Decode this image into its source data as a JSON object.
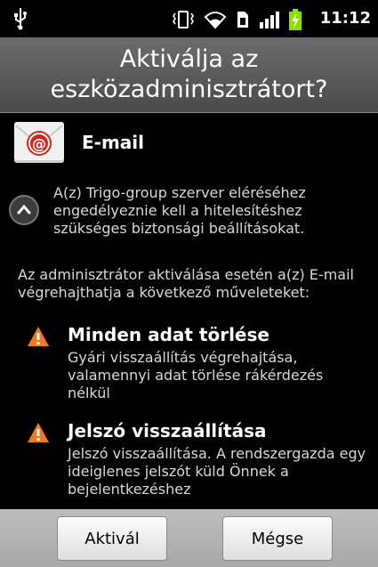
{
  "status_bar": {
    "time": "11:12",
    "icons": [
      "usb-icon",
      "vibrate-icon",
      "wifi-icon",
      "sim-icon",
      "signal-icon",
      "battery-charging-icon"
    ]
  },
  "dialog": {
    "title_line1": "Aktiválja az",
    "title_line2": "eszközadminisztrátort?"
  },
  "app": {
    "name": "E-mail",
    "icon": "email-app-icon"
  },
  "description": "A(z) Trigo-group szerver eléréséhez engedélyeznie kell a hitelesítéshez szükséges biztonsági beállításokat.",
  "admin_text": "Az adminisztrátor aktiválása esetén a(z) E-mail végrehajthatja a következő műveleteket:",
  "permissions": [
    {
      "title": "Minden adat törlése",
      "description": "Gyári visszaállítás végrehajtása, valamennyi adat törlése rákérdezés nélkül"
    },
    {
      "title": "Jelszó visszaállítása",
      "description": "Jelszó visszaállítása. A rendszergazda egy ideiglenes jelszót küld Önnek a bejelentkezéshez"
    }
  ],
  "buttons": {
    "activate": "Aktivál",
    "cancel": "Mégse"
  },
  "colors": {
    "warning": "#f07a1e",
    "battery_charging": "#8ce000"
  }
}
